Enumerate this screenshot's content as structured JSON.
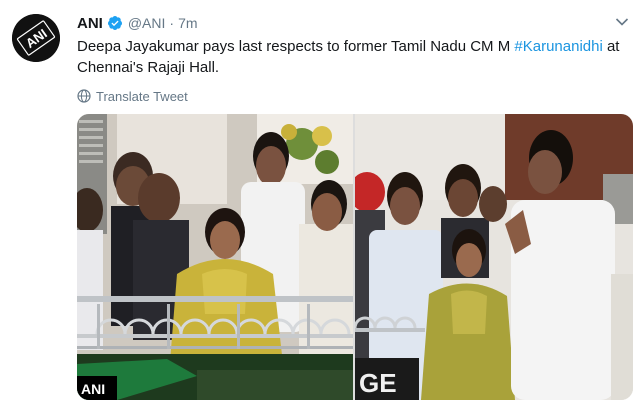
{
  "tweet": {
    "author_name": "ANI",
    "handle": "@ANI",
    "separator": "·",
    "time": "7m",
    "text_before": "Deepa Jayakumar pays last respects to former Tamil Nadu CM M ",
    "hashtag": "#Karunanidhi",
    "text_after": " at Chennai's Rajaji Hall.",
    "translate_label": "Translate Tweet"
  },
  "avatar": {
    "logo_text": "ANI"
  },
  "media": {
    "photo_left_visible_text": "ANI",
    "photo_right_visible_text": "GE"
  },
  "colors": {
    "link": "#1b95e0",
    "secondary": "#657786",
    "verified": "#1da1f2"
  },
  "icons": [
    "verified-badge-icon",
    "caret-down-icon",
    "globe-icon"
  ]
}
